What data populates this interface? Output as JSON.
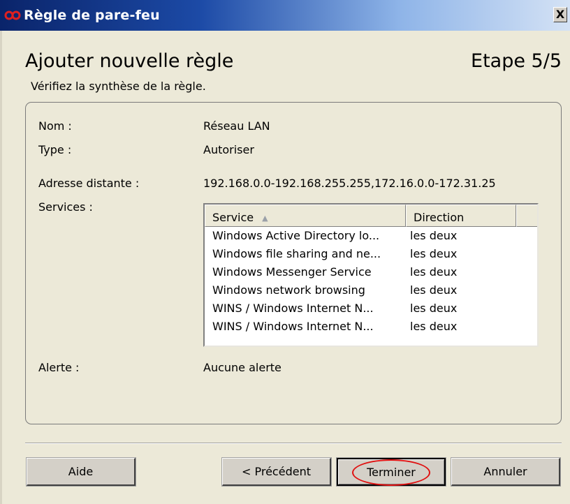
{
  "window": {
    "title": "Règle de pare-feu",
    "close_label": "X"
  },
  "wizard": {
    "heading": "Ajouter nouvelle règle",
    "step": "Etape 5/5",
    "subtitle": "Vérifiez la synthèse de la règle."
  },
  "summary": {
    "name_label": "Nom :",
    "name_value": "Réseau LAN",
    "type_label": "Type :",
    "type_value": "Autoriser",
    "address_label": "Adresse distante :",
    "address_value": "192.168.0.0-192.168.255.255,172.16.0.0-172.31.25",
    "services_label": "Services :",
    "alert_label": "Alerte :",
    "alert_value": "Aucune alerte"
  },
  "services_table": {
    "columns": [
      "Service",
      "Direction"
    ],
    "sort_column": "Service",
    "sort_direction": "ascending",
    "rows": [
      {
        "service": "Windows Active Directory lo...",
        "direction": "les deux"
      },
      {
        "service": "Windows file sharing and ne...",
        "direction": "les deux"
      },
      {
        "service": "Windows Messenger Service",
        "direction": "les deux"
      },
      {
        "service": "Windows network browsing",
        "direction": "les deux"
      },
      {
        "service": "WINS / Windows Internet N...",
        "direction": "les deux"
      },
      {
        "service": "WINS / Windows Internet N...",
        "direction": "les deux"
      }
    ]
  },
  "buttons": {
    "help": "Aide",
    "previous": "< Précédent",
    "finish": "Terminer",
    "cancel": "Annuler"
  },
  "icons": {
    "app": "infinity-logo-icon",
    "sort": "sort-ascending-icon"
  },
  "colors": {
    "title_gradient_start": "#0a246a",
    "title_gradient_end": "#d4e2f5",
    "dialog_bg": "#ece9d8",
    "annotation": "#e01010",
    "logo": "#e02020"
  }
}
